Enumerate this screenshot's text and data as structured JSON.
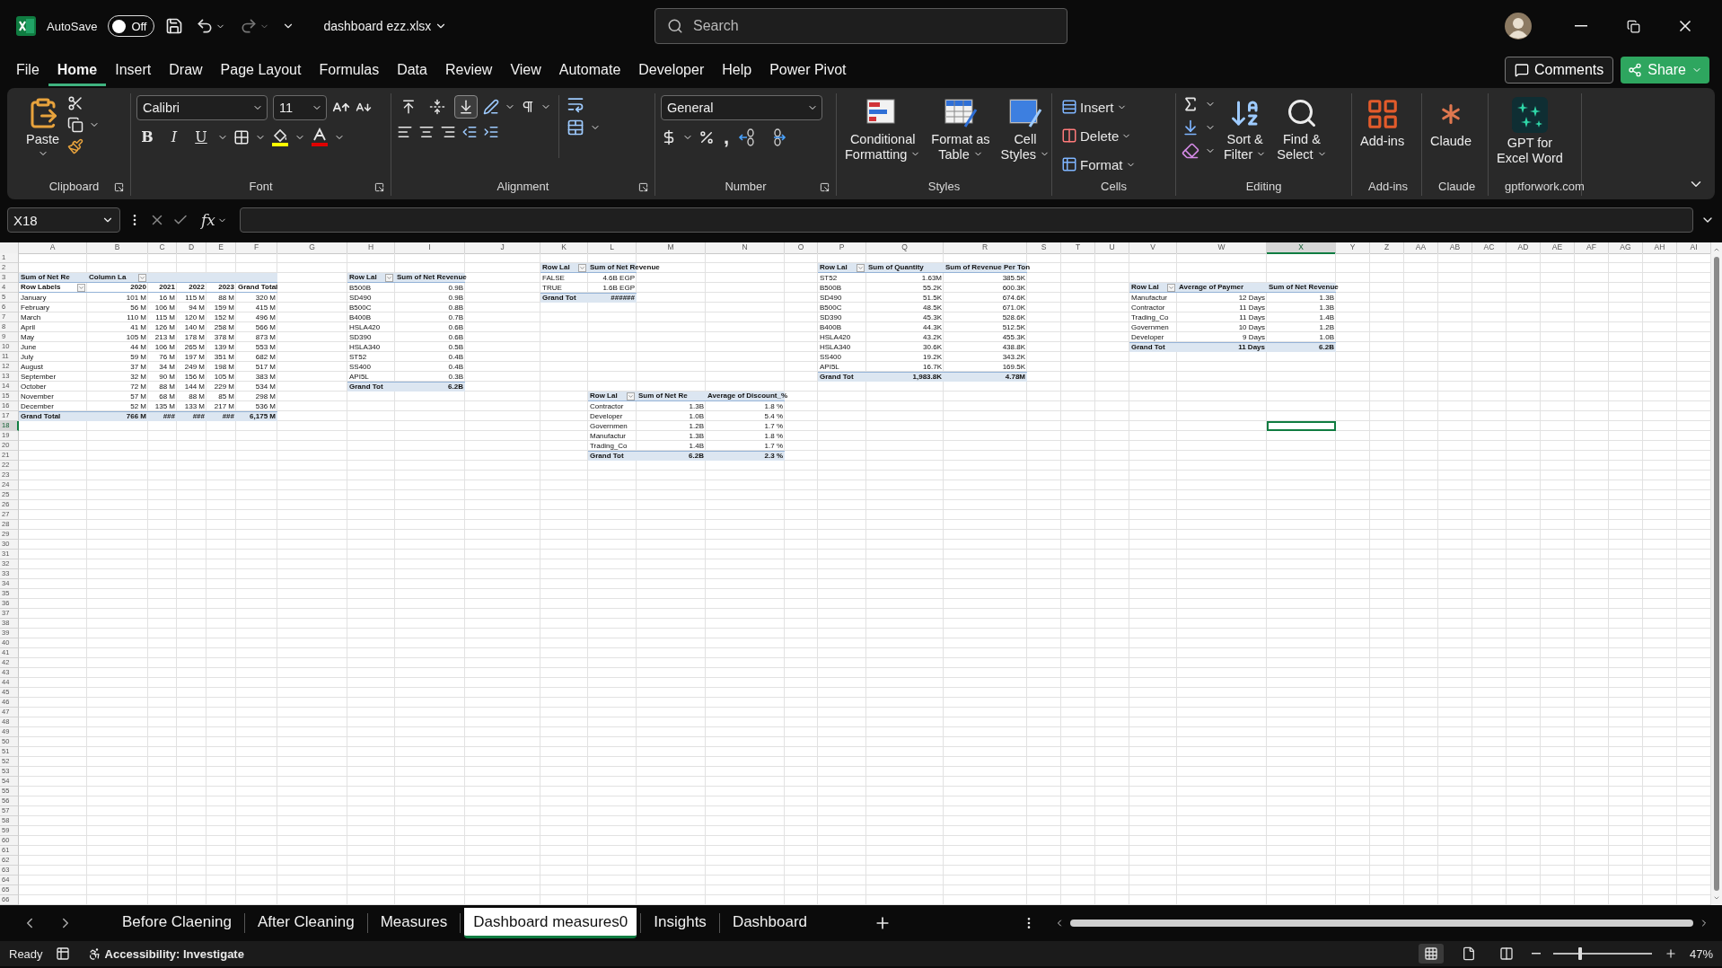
{
  "title_bar": {
    "autosave_label": "AutoSave",
    "autosave": {
      "on": false,
      "label": "Off"
    },
    "file_name": "dashboard ezz.xlsx",
    "search": {
      "placeholder": "Search"
    }
  },
  "menu_tabs": [
    {
      "label": "File",
      "selected": false
    },
    {
      "label": "Home",
      "selected": true
    },
    {
      "label": "Insert",
      "selected": false
    },
    {
      "label": "Draw",
      "selected": false
    },
    {
      "label": "Page Layout",
      "selected": false
    },
    {
      "label": "Formulas",
      "selected": false
    },
    {
      "label": "Data",
      "selected": false
    },
    {
      "label": "Review",
      "selected": false
    },
    {
      "label": "View",
      "selected": false
    },
    {
      "label": "Automate",
      "selected": false
    },
    {
      "label": "Developer",
      "selected": false
    },
    {
      "label": "Help",
      "selected": false
    },
    {
      "label": "Power Pivot",
      "selected": false
    }
  ],
  "comments_button": "Comments",
  "share_button": "Share",
  "ribbon": {
    "clipboard": {
      "label": "Clipboard",
      "paste": "Paste"
    },
    "font": {
      "label": "Font",
      "font_name": "Calibri",
      "font_size": "11",
      "bold": "B",
      "italic": "I",
      "underline": "U"
    },
    "alignment": {
      "label": "Alignment",
      "vertical_align": [
        {
          "selected": false
        },
        {
          "selected": false
        },
        {
          "selected": true
        }
      ]
    },
    "number": {
      "label": "Number",
      "format": "General",
      "comma": ","
    },
    "styles": {
      "label": "Styles",
      "buttons": [
        [
          "Conditional",
          "Formatting"
        ],
        [
          "Format as",
          "Table"
        ],
        [
          "Cell",
          "Styles"
        ]
      ]
    },
    "cells": {
      "label": "Cells",
      "buttons": [
        "Insert",
        "Delete",
        "Format"
      ]
    },
    "editing": {
      "label": "Editing",
      "buttons": [
        [
          "Sort &",
          "Filter"
        ],
        [
          "Find &",
          "Select"
        ]
      ]
    },
    "addins": {
      "label": "Add-ins",
      "button": [
        "Add-ins"
      ]
    },
    "claude": {
      "label": "Claude",
      "button": [
        "Claude"
      ]
    },
    "gpt": {
      "label": "gptforwork.com",
      "button": [
        "GPT for",
        "Excel Word"
      ]
    }
  },
  "formula_bar": {
    "name_box": "X18",
    "function_label": "fx"
  },
  "sheet": {
    "columns": [
      {
        "label": "A",
        "selected": false
      },
      {
        "label": "B",
        "selected": false
      },
      {
        "label": "C",
        "selected": false
      },
      {
        "label": "D",
        "selected": false
      },
      {
        "label": "E",
        "selected": false
      },
      {
        "label": "F",
        "selected": false
      },
      {
        "label": "G",
        "selected": false
      },
      {
        "label": "H",
        "selected": false
      },
      {
        "label": "I",
        "selected": false
      },
      {
        "label": "J",
        "selected": false
      },
      {
        "label": "K",
        "selected": false
      },
      {
        "label": "L",
        "selected": false
      },
      {
        "label": "M",
        "selected": false
      },
      {
        "label": "N",
        "selected": false
      },
      {
        "label": "O",
        "selected": false
      },
      {
        "label": "P",
        "selected": false
      },
      {
        "label": "Q",
        "selected": false
      },
      {
        "label": "R",
        "selected": false
      },
      {
        "label": "S",
        "selected": false
      },
      {
        "label": "T",
        "selected": false
      },
      {
        "label": "U",
        "selected": false
      },
      {
        "label": "V",
        "selected": false
      },
      {
        "label": "W",
        "selected": false
      },
      {
        "label": "X",
        "selected": true
      },
      {
        "label": "Y",
        "selected": false
      },
      {
        "label": "Z",
        "selected": false
      },
      {
        "label": "AA",
        "selected": false
      },
      {
        "label": "AB",
        "selected": false
      },
      {
        "label": "AC",
        "selected": false
      },
      {
        "label": "AD",
        "selected": false
      },
      {
        "label": "AE",
        "selected": false
      },
      {
        "label": "AF",
        "selected": false
      },
      {
        "label": "AG",
        "selected": false
      },
      {
        "label": "AH",
        "selected": false
      },
      {
        "label": "AI",
        "selected": false
      }
    ],
    "rows": [
      {
        "label": "1",
        "selected": false
      },
      {
        "label": "2",
        "selected": false
      },
      {
        "label": "3",
        "selected": false
      },
      {
        "label": "4",
        "selected": false
      },
      {
        "label": "5",
        "selected": false
      },
      {
        "label": "6",
        "selected": false
      },
      {
        "label": "7",
        "selected": false
      },
      {
        "label": "8",
        "selected": false
      },
      {
        "label": "9",
        "selected": false
      },
      {
        "label": "10",
        "selected": false
      },
      {
        "label": "11",
        "selected": false
      },
      {
        "label": "12",
        "selected": false
      },
      {
        "label": "13",
        "selected": false
      },
      {
        "label": "14",
        "selected": false
      },
      {
        "label": "15",
        "selected": false
      },
      {
        "label": "16",
        "selected": false
      },
      {
        "label": "17",
        "selected": false
      },
      {
        "label": "18",
        "selected": true
      },
      {
        "label": "19",
        "selected": false
      },
      {
        "label": "20",
        "selected": false
      },
      {
        "label": "21",
        "selected": false
      },
      {
        "label": "22",
        "selected": false
      },
      {
        "label": "23",
        "selected": false
      },
      {
        "label": "24",
        "selected": false
      },
      {
        "label": "25",
        "selected": false
      },
      {
        "label": "26",
        "selected": false
      },
      {
        "label": "27",
        "selected": false
      },
      {
        "label": "28",
        "selected": false
      },
      {
        "label": "29",
        "selected": false
      },
      {
        "label": "30",
        "selected": false
      },
      {
        "label": "31",
        "selected": false
      },
      {
        "label": "32",
        "selected": false
      },
      {
        "label": "33",
        "selected": false
      },
      {
        "label": "34",
        "selected": false
      },
      {
        "label": "35",
        "selected": false
      },
      {
        "label": "36",
        "selected": false
      },
      {
        "label": "37",
        "selected": false
      },
      {
        "label": "38",
        "selected": false
      },
      {
        "label": "39",
        "selected": false
      },
      {
        "label": "40",
        "selected": false
      },
      {
        "label": "41",
        "selected": false
      },
      {
        "label": "42",
        "selected": false
      },
      {
        "label": "43",
        "selected": false
      },
      {
        "label": "44",
        "selected": false
      },
      {
        "label": "45",
        "selected": false
      },
      {
        "label": "46",
        "selected": false
      },
      {
        "label": "47",
        "selected": false
      },
      {
        "label": "48",
        "selected": false
      },
      {
        "label": "49",
        "selected": false
      },
      {
        "label": "50",
        "selected": false
      },
      {
        "label": "51",
        "selected": false
      },
      {
        "label": "52",
        "selected": false
      },
      {
        "label": "53",
        "selected": false
      },
      {
        "label": "54",
        "selected": false
      },
      {
        "label": "55",
        "selected": false
      },
      {
        "label": "56",
        "selected": false
      },
      {
        "label": "57",
        "selected": false
      },
      {
        "label": "58",
        "selected": false
      },
      {
        "label": "59",
        "selected": false
      },
      {
        "label": "60",
        "selected": false
      },
      {
        "label": "61",
        "selected": false
      },
      {
        "label": "62",
        "selected": false
      },
      {
        "label": "63",
        "selected": false
      },
      {
        "label": "64",
        "selected": false
      },
      {
        "label": "65",
        "selected": false
      },
      {
        "label": "66",
        "selected": false
      }
    ],
    "pivot_tables": [
      {
        "rows": [
          {
            "kind": "header",
            "cells": [
              "Sum of Net Re",
              {
                "text": "Column La",
                "filter_button": true
              }
            ]
          },
          {
            "kind": "subheader",
            "cells": [
              {
                "text": "Row Labels",
                "filter_button": true
              },
              "2020",
              "2021",
              "2022",
              "2023",
              "Grand Total"
            ]
          },
          {
            "kind": "item",
            "cells": [
              "January",
              "101 M",
              "16 M",
              "115 M",
              "88 M",
              "320 M"
            ]
          },
          {
            "kind": "item",
            "cells": [
              "February",
              "56 M",
              "106 M",
              "94 M",
              "159 M",
              "415 M"
            ]
          },
          {
            "kind": "item",
            "cells": [
              "March",
              "110 M",
              "115 M",
              "120 M",
              "152 M",
              "496 M"
            ]
          },
          {
            "kind": "item",
            "cells": [
              "April",
              "41 M",
              "126 M",
              "140 M",
              "258 M",
              "566 M"
            ]
          },
          {
            "kind": "item",
            "cells": [
              "May",
              "105 M",
              "213 M",
              "178 M",
              "378 M",
              "873 M"
            ]
          },
          {
            "kind": "item",
            "cells": [
              "June",
              "44 M",
              "106 M",
              "265 M",
              "139 M",
              "553 M"
            ]
          },
          {
            "kind": "item",
            "cells": [
              "July",
              "59 M",
              "76 M",
              "197 M",
              "351 M",
              "682 M"
            ]
          },
          {
            "kind": "item",
            "cells": [
              "August",
              "37 M",
              "34 M",
              "249 M",
              "198 M",
              "517 M"
            ]
          },
          {
            "kind": "item",
            "cells": [
              "September",
              "32 M",
              "90 M",
              "156 M",
              "105 M",
              "383 M"
            ]
          },
          {
            "kind": "item",
            "cells": [
              "October",
              "72 M",
              "88 M",
              "144 M",
              "229 M",
              "534 M"
            ]
          },
          {
            "kind": "item",
            "cells": [
              "November",
              "57 M",
              "68 M",
              "88 M",
              "85 M",
              "298 M"
            ]
          },
          {
            "kind": "item",
            "cells": [
              "December",
              "52 M",
              "135 M",
              "133 M",
              "217 M",
              "536 M"
            ]
          },
          {
            "kind": "total",
            "cells": [
              "Grand Total",
              "766 M",
              "###",
              "###",
              "###",
              "6,175 M"
            ]
          }
        ]
      },
      {
        "rows": [
          {
            "kind": "header",
            "cells": [
              {
                "text": "Row Lal",
                "filter_button": true
              },
              "Sum of Net Revenue"
            ]
          },
          {
            "kind": "item",
            "cells": [
              "B500B",
              "0.9B"
            ]
          },
          {
            "kind": "item",
            "cells": [
              "SD490",
              "0.9B"
            ]
          },
          {
            "kind": "item",
            "cells": [
              "B500C",
              "0.8B"
            ]
          },
          {
            "kind": "item",
            "cells": [
              "B400B",
              "0.7B"
            ]
          },
          {
            "kind": "item",
            "cells": [
              "HSLA420",
              "0.6B"
            ]
          },
          {
            "kind": "item",
            "cells": [
              "SD390",
              "0.6B"
            ]
          },
          {
            "kind": "item",
            "cells": [
              "HSLA340",
              "0.5B"
            ]
          },
          {
            "kind": "item",
            "cells": [
              "ST52",
              "0.4B"
            ]
          },
          {
            "kind": "item",
            "cells": [
              "SS400",
              "0.4B"
            ]
          },
          {
            "kind": "item",
            "cells": [
              "API5L",
              "0.3B"
            ]
          },
          {
            "kind": "total",
            "cells": [
              "Grand Tot",
              "6.2B"
            ]
          }
        ]
      },
      {
        "rows": [
          {
            "kind": "header",
            "cells": [
              {
                "text": "Row Lal",
                "filter_button": true
              },
              "Sum of Net Revenue"
            ]
          },
          {
            "kind": "item",
            "cells": [
              "FALSE",
              "4.6B EGP"
            ]
          },
          {
            "kind": "item",
            "cells": [
              "TRUE",
              "1.6B EGP"
            ]
          },
          {
            "kind": "total",
            "cells": [
              "Grand Tot",
              "######"
            ]
          }
        ]
      },
      {
        "rows": [
          {
            "kind": "header",
            "cells": [
              {
                "text": "Row Lal",
                "filter_button": true
              },
              "Sum of Net Re",
              "Average of Discount_%"
            ]
          },
          {
            "kind": "item",
            "cells": [
              "Contractor",
              "1.3B",
              "1.8 %"
            ]
          },
          {
            "kind": "item",
            "cells": [
              "Developer",
              "1.0B",
              "5.4 %"
            ]
          },
          {
            "kind": "item",
            "cells": [
              "Governmen",
              "1.2B",
              "1.7 %"
            ]
          },
          {
            "kind": "item",
            "cells": [
              "Manufactur",
              "1.3B",
              "1.8 %"
            ]
          },
          {
            "kind": "item",
            "cells": [
              "Trading_Co",
              "1.4B",
              "1.7 %"
            ]
          },
          {
            "kind": "total",
            "cells": [
              "Grand Tot",
              "6.2B",
              "2.3 %"
            ]
          }
        ]
      },
      {
        "rows": [
          {
            "kind": "header",
            "cells": [
              {
                "text": "Row Lal",
                "filter_button": true
              },
              "Sum of Quantity",
              "Sum of Revenue Per Ton"
            ]
          },
          {
            "kind": "item",
            "cells": [
              "ST52",
              "1.63M",
              "385.5K"
            ]
          },
          {
            "kind": "item",
            "cells": [
              "B500B",
              "55.2K",
              "600.3K"
            ]
          },
          {
            "kind": "item",
            "cells": [
              "SD490",
              "51.5K",
              "674.6K"
            ]
          },
          {
            "kind": "item",
            "cells": [
              "B500C",
              "48.5K",
              "671.0K"
            ]
          },
          {
            "kind": "item",
            "cells": [
              "SD390",
              "45.3K",
              "528.6K"
            ]
          },
          {
            "kind": "item",
            "cells": [
              "B400B",
              "44.3K",
              "512.5K"
            ]
          },
          {
            "kind": "item",
            "cells": [
              "HSLA420",
              "43.2K",
              "455.3K"
            ]
          },
          {
            "kind": "item",
            "cells": [
              "HSLA340",
              "30.6K",
              "438.8K"
            ]
          },
          {
            "kind": "item",
            "cells": [
              "SS400",
              "19.2K",
              "343.2K"
            ]
          },
          {
            "kind": "item",
            "cells": [
              "API5L",
              "16.7K",
              "169.5K"
            ]
          },
          {
            "kind": "total",
            "cells": [
              "Grand Tot",
              "1,983.8K",
              "4.78M"
            ]
          }
        ]
      },
      {
        "rows": [
          {
            "kind": "header",
            "cells": [
              {
                "text": "Row Lal",
                "filter_button": true
              },
              "Average of Paymer",
              "Sum of Net Revenue"
            ]
          },
          {
            "kind": "item",
            "cells": [
              "Manufactur",
              "12 Days",
              "1.3B"
            ]
          },
          {
            "kind": "item",
            "cells": [
              "Contractor",
              "11 Days",
              "1.3B"
            ]
          },
          {
            "kind": "item",
            "cells": [
              "Trading_Co",
              "11 Days",
              "1.4B"
            ]
          },
          {
            "kind": "item",
            "cells": [
              "Governmen",
              "10 Days",
              "1.2B"
            ]
          },
          {
            "kind": "item",
            "cells": [
              "Developer",
              "9 Days",
              "1.0B"
            ]
          },
          {
            "kind": "total",
            "cells": [
              "Grand Tot",
              "11 Days",
              "6.2B"
            ]
          }
        ]
      }
    ]
  },
  "sheet_tabs": [
    {
      "label": "Before Claening",
      "selected": false
    },
    {
      "label": "After Cleaning",
      "selected": false
    },
    {
      "label": "Measures",
      "selected": false
    },
    {
      "label": "Dashboard measures0",
      "selected": true
    },
    {
      "label": "Insights",
      "selected": false
    },
    {
      "label": "Dashboard",
      "selected": false
    }
  ],
  "status_bar": {
    "ready": "Ready",
    "accessibility": "Accessibility: Investigate",
    "views": [
      {
        "kind": "normal",
        "selected": true
      },
      {
        "kind": "page_layout",
        "selected": false
      },
      {
        "kind": "page_break",
        "selected": false
      }
    ],
    "zoom": {
      "level": 0.27,
      "reading": "47%"
    }
  }
}
